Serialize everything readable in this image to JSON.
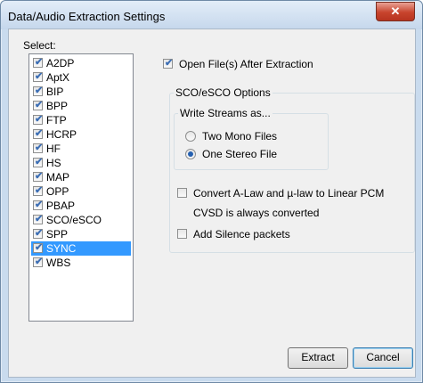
{
  "window": {
    "title": "Data/Audio Extraction Settings",
    "close_glyph": "✕"
  },
  "select": {
    "label": "Select:",
    "items": [
      {
        "label": "A2DP",
        "checked": true,
        "selected": false
      },
      {
        "label": "AptX",
        "checked": true,
        "selected": false
      },
      {
        "label": "BIP",
        "checked": true,
        "selected": false
      },
      {
        "label": "BPP",
        "checked": true,
        "selected": false
      },
      {
        "label": "FTP",
        "checked": true,
        "selected": false
      },
      {
        "label": "HCRP",
        "checked": true,
        "selected": false
      },
      {
        "label": "HF",
        "checked": true,
        "selected": false
      },
      {
        "label": "HS",
        "checked": true,
        "selected": false
      },
      {
        "label": "MAP",
        "checked": true,
        "selected": false
      },
      {
        "label": "OPP",
        "checked": true,
        "selected": false
      },
      {
        "label": "PBAP",
        "checked": true,
        "selected": false
      },
      {
        "label": "SCO/eSCO",
        "checked": true,
        "selected": false
      },
      {
        "label": "SPP",
        "checked": true,
        "selected": false
      },
      {
        "label": "SYNC",
        "checked": true,
        "selected": true
      },
      {
        "label": "WBS",
        "checked": true,
        "selected": false
      }
    ]
  },
  "open_after": {
    "label": "Open File(s) After Extraction",
    "checked": true
  },
  "sco": {
    "title": "SCO/eSCO Options",
    "write_streams": {
      "title": "Write Streams as...",
      "options": [
        {
          "label": "Two Mono Files",
          "selected": false
        },
        {
          "label": "One Stereo File",
          "selected": true
        }
      ]
    },
    "convert": {
      "label": "Convert A-Law and µ-law to Linear PCM",
      "checked": false
    },
    "cvsd_note": "CVSD is always converted",
    "silence": {
      "label": "Add Silence packets",
      "checked": false
    }
  },
  "buttons": {
    "extract": "Extract",
    "cancel": "Cancel"
  },
  "colors": {
    "selection": "#3399ff",
    "check": "#3c6eb4",
    "close": "#c8442d"
  }
}
